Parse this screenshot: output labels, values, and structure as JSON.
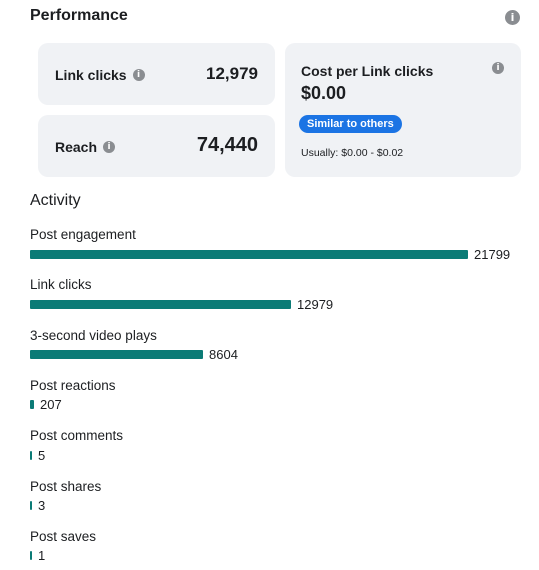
{
  "performance": {
    "title": "Performance",
    "info_icon": "info-icon",
    "link_clicks": {
      "label": "Link clicks",
      "value": "12,979"
    },
    "reach": {
      "label": "Reach",
      "value": "74,440"
    },
    "cost_per_link_click": {
      "label": "Cost per Link clicks",
      "value": "$0.00",
      "badge": "Similar to others",
      "usual_range": "Usually: $0.00 - $0.02"
    },
    "colors": {
      "badge": "#1b74e4",
      "card_bg": "#f0f2f5"
    }
  },
  "activity": {
    "title": "Activity",
    "bar_color": "#0b7b76",
    "max_value": 21799,
    "items": [
      {
        "label": "Post engagement",
        "value": 21799
      },
      {
        "label": "Link clicks",
        "value": 12979
      },
      {
        "label": "3-second video plays",
        "value": 8604
      },
      {
        "label": "Post reactions",
        "value": 207
      },
      {
        "label": "Post comments",
        "value": 5
      },
      {
        "label": "Post shares",
        "value": 3
      },
      {
        "label": "Post saves",
        "value": 1
      }
    ]
  }
}
